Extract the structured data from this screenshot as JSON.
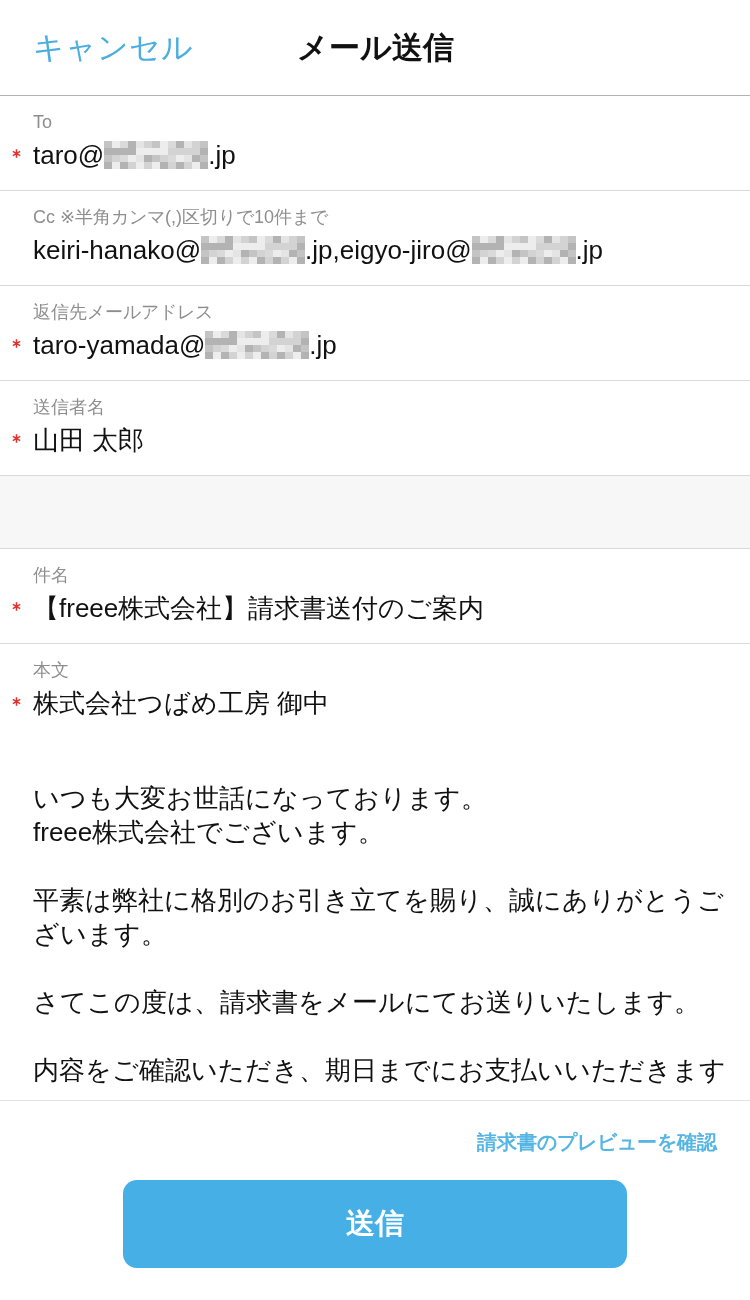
{
  "header": {
    "cancel_label": "キャンセル",
    "title": "メール送信"
  },
  "sections": [
    {
      "fields": [
        {
          "label": "To",
          "required": true,
          "value": [
            {
              "kind": "text",
              "text": "taro@"
            },
            {
              "kind": "redacted"
            },
            {
              "kind": "text",
              "text": ".jp"
            }
          ]
        },
        {
          "label": "Cc ※半角カンマ(,)区切りで10件まで",
          "required": false,
          "value": [
            {
              "kind": "text",
              "text": "keiri-hanako@"
            },
            {
              "kind": "redacted"
            },
            {
              "kind": "text",
              "text": ".jp,eigyo-jiro@"
            },
            {
              "kind": "redacted"
            },
            {
              "kind": "text",
              "text": ".jp"
            }
          ]
        },
        {
          "label": "返信先メールアドレス",
          "required": true,
          "value": [
            {
              "kind": "text",
              "text": "taro-yamada@"
            },
            {
              "kind": "redacted"
            },
            {
              "kind": "text",
              "text": ".jp"
            }
          ]
        },
        {
          "label": "送信者名",
          "required": true,
          "value": [
            {
              "kind": "text",
              "text": "山田 太郎"
            }
          ]
        }
      ]
    },
    {
      "fields": [
        {
          "label": "件名",
          "required": true,
          "value": [
            {
              "kind": "text",
              "text": "【freee株式会社】請求書送付のご案内"
            }
          ]
        },
        {
          "label": "本文",
          "required": true,
          "value": [
            {
              "kind": "text",
              "text": "株式会社つばめ工房 御中"
            }
          ],
          "paragraphs": [
            "いつも大変お世話になっております。\nfreee株式会社でございます。",
            "平素は弊社に格別のお引き立てを賜り、誠にありがとうございます。",
            "さてこの度は、請求書をメールにてお送りいたします。",
            "内容をご確認いただき、期日までにお支払いいただきます"
          ]
        }
      ]
    }
  ],
  "footer": {
    "preview_link": "請求書のプレビューを確認",
    "send_button": "送信"
  }
}
